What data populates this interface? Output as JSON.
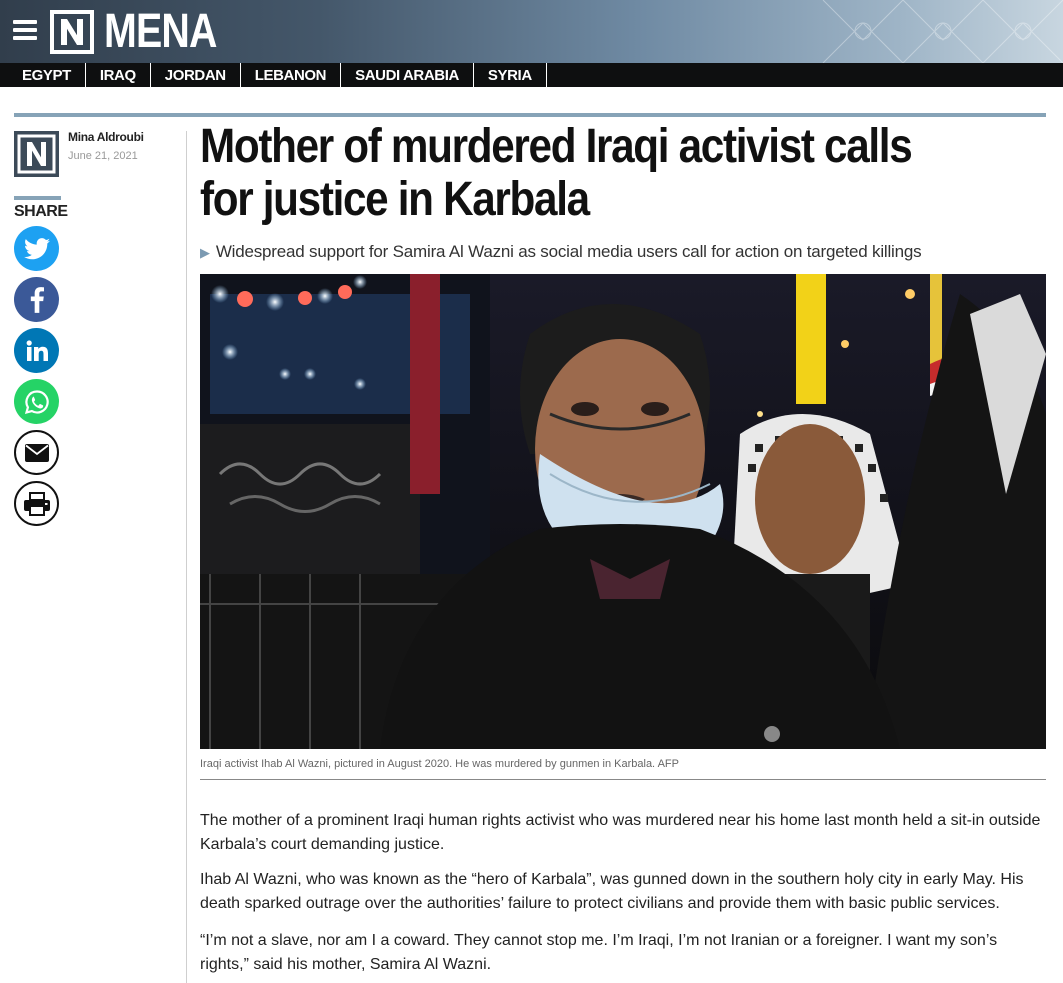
{
  "header": {
    "brand": "MENA"
  },
  "nav": {
    "items": [
      "EGYPT",
      "IRAQ",
      "JORDAN",
      "LEBANON",
      "SAUDI ARABIA",
      "SYRIA"
    ]
  },
  "author": {
    "name": "Mina Aldroubi",
    "date": "June 21, 2021"
  },
  "share": {
    "label": "SHARE",
    "buttons": [
      {
        "icon": "twitter-icon",
        "color": "#1da1f2"
      },
      {
        "icon": "facebook-icon",
        "color": "#3b5998"
      },
      {
        "icon": "linkedin-icon",
        "color": "#0077b5"
      },
      {
        "icon": "whatsapp-icon",
        "color": "#25d366"
      },
      {
        "icon": "email-icon",
        "color": "#ffffff"
      },
      {
        "icon": "print-icon",
        "color": "#ffffff"
      }
    ]
  },
  "article": {
    "headline": "Mother of murdered Iraqi activist calls for justice in Karbala",
    "standfirst": "Widespread support for Samira Al Wazni as social media users call for action on targeted killings",
    "caption": "Iraqi activist Ihab Al Wazni, pictured in August 2020. He was murdered by gunmen in Karbala. AFP",
    "paragraphs": [
      "The mother of a prominent Iraqi human rights activist who was murdered near his home last month held a sit-in outside Karbala’s court demanding justice.",
      "Ihab Al Wazni, who was known as the “hero of Karbala”, was gunned down in the southern holy city in early May. His death sparked outrage over the authorities’ failure to protect civilians and provide them with basic public services.",
      "“I’m not a slave, nor am I a coward. They cannot stop me. I’m Iraqi, I’m not Iranian or a foreigner. I want my son’s rights,” said his mother, Samira Al Wazni."
    ]
  },
  "colors": {
    "accent": "#86a3b7",
    "nav_bg": "#0e0f10"
  }
}
